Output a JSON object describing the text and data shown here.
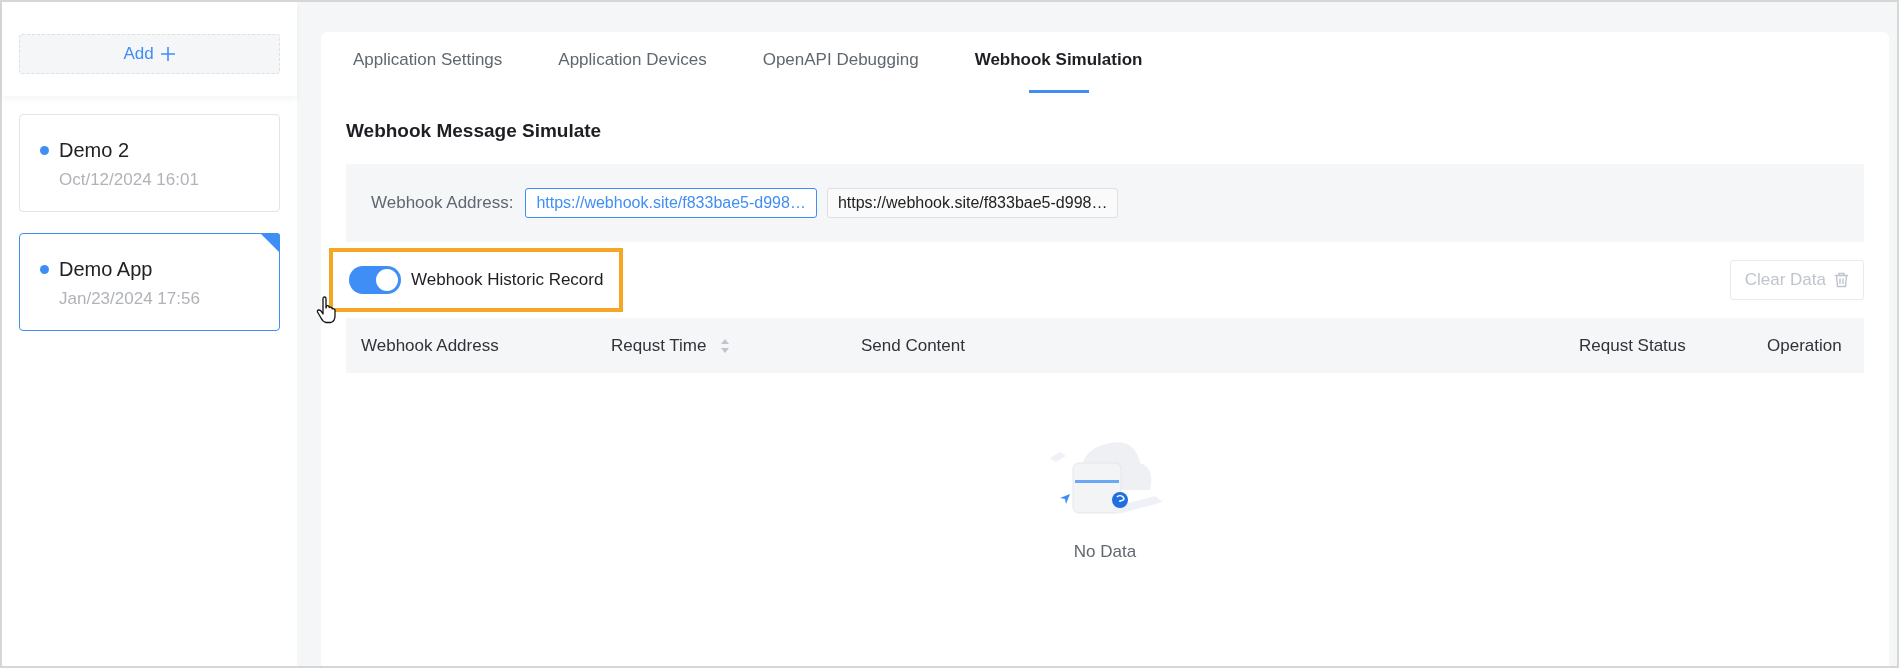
{
  "sidebar": {
    "add_button": {
      "label": "Add"
    },
    "apps": [
      {
        "name": "Demo 2",
        "date": "Oct/12/2024 16:01",
        "selected": false
      },
      {
        "name": "Demo App",
        "date": "Jan/23/2024 17:56",
        "selected": true
      }
    ]
  },
  "tabs": [
    {
      "label": "Application Settings",
      "selected": false
    },
    {
      "label": "Application Devices",
      "selected": false
    },
    {
      "label": "OpenAPI Debugging",
      "selected": false
    },
    {
      "label": "Webhook Simulation",
      "selected": true
    }
  ],
  "heading": "Webhook Message Simulate",
  "address": {
    "label": "Webhook Address:",
    "values": [
      {
        "kind": "link",
        "text": "https://webhook.site/f833bae5-d998…"
      },
      {
        "kind": "plain",
        "text": "https://webhook.site/f833bae5-d998…"
      }
    ]
  },
  "history_toggle": {
    "label": "Webhook Historic Record",
    "on": true,
    "highlighted": true
  },
  "clear_button": {
    "label": "Clear Data",
    "disabled": true
  },
  "table": {
    "columns": [
      {
        "label": "Webhook Address",
        "sortable": false
      },
      {
        "label": "Requst Time",
        "sortable": true
      },
      {
        "label": "Send Content",
        "sortable": false
      },
      {
        "label": "Requst Status",
        "sortable": false
      },
      {
        "label": "Operation",
        "sortable": false
      }
    ],
    "empty_text": "No Data"
  }
}
